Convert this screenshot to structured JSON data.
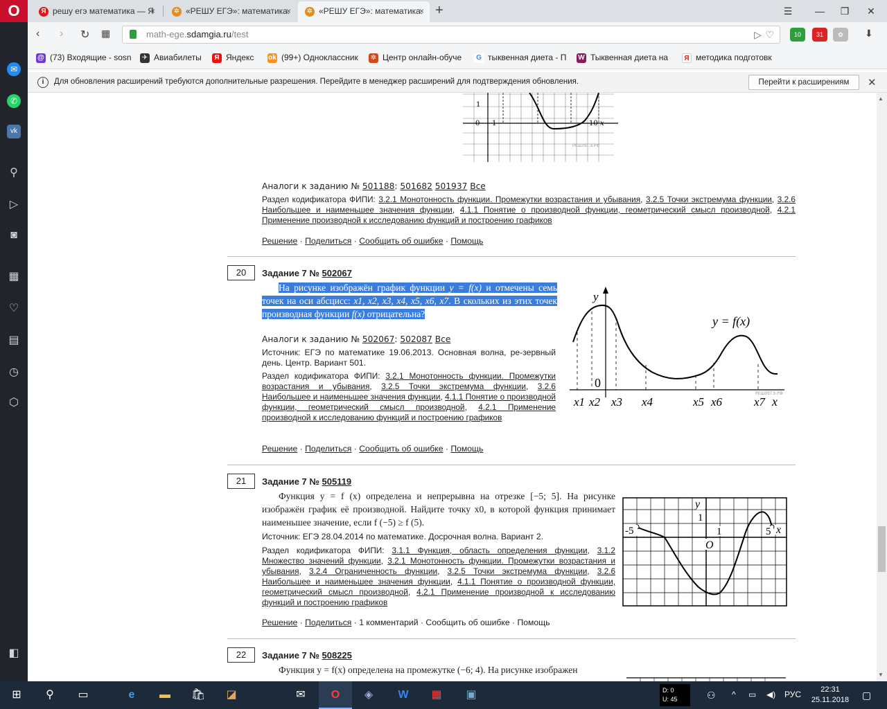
{
  "tabs": [
    {
      "title": "решу егэ математика — Я",
      "icon": "yandex-icon"
    },
    {
      "title": "«РЕШУ ЕГЭ»: математика.",
      "icon": "sdamgia-icon"
    },
    {
      "title": "«РЕШУ ЕГЭ»: математика.",
      "icon": "sdamgia-icon"
    }
  ],
  "address": {
    "host": "math-ege.",
    "domain": "sdamgia.ru",
    "path": "/test"
  },
  "ext_badges": {
    "green": "10",
    "red": "31"
  },
  "bookmarks": [
    "(73) Входящие - sosn",
    "Авиабилеты",
    "Яндекс",
    "(99+) Одноклассник",
    "Центр онлайн-обуче",
    "тыквенная диета - П",
    "Тыквенная диета на",
    "методика подготовк"
  ],
  "info": {
    "text": "Для обновления расширений требуются дополнительные разрешения. Перейдите в менеджер расширений для подтверждения обновления.",
    "button": "Перейти к расширениям"
  },
  "top": {
    "analog_prefix": "Аналоги к заданию № ",
    "analog_main": "501188",
    "analog_links": [
      "501682",
      "501937",
      "Все"
    ],
    "codif_prefix": "Раздел кодификатора ФИПИ:",
    "codif_links": [
      "3.2.1 Монотонность функции. Промежутки возрастания и убывания",
      "3.2.5 Точки экстремума функции",
      "3.2.6 Наибольшее и наименьшее значения функции",
      "4.1.1 Понятие о производной функции, геометрический смысл производной",
      "4.2.1 Применение производной к исследованию функций и построению графиков"
    ],
    "footer": [
      "Решение",
      "Поделиться",
      "Сообщить об ошибке",
      "Помощь"
    ]
  },
  "top_graph": {
    "labels": [
      "1",
      "0",
      "1",
      "10",
      "x"
    ],
    "wm": "РЕШУЕГЭ.РФ"
  },
  "t20": {
    "number": "20",
    "title": "Задание 7 № ",
    "id": "502067",
    "q1": "На рисунке изображён график функции ",
    "q_fx": "y = f(x)",
    "q2": " и отмечены семь точек на оси абсцисс: ",
    "q_pts": "x1, x2, x3, x4, x5, x6, x7",
    "q3": ". В скольких из этих точек производная функции ",
    "q_f": "f(x)",
    "q4": " отрицательна?",
    "analog_prefix": "Аналоги к заданию № ",
    "analog_main": "502067",
    "analog_links": [
      "502087",
      "Все"
    ],
    "source": "Источник: ЕГЭ по математике 19.06.2013. Основная волна, ре-зервный день. Центр. Вариант 501.",
    "codif_prefix": "Раздел кодификатора ФИПИ:",
    "codif_links": [
      "3.2.1 Монотонность функции. Промежутки возрастания и убывания",
      "3.2.5 Точки экстремума функции",
      "3.2.6 Наибольшее и наименьшее значения функции",
      "4.1.1 Понятие о производной функции, геометрический смысл производной",
      "4.2.1 Применение производной к исследованию функций и построению графиков"
    ],
    "footer": [
      "Решение",
      "Поделиться",
      "Сообщить об ошибке",
      "Помощь"
    ],
    "graph": {
      "ylabel": "y",
      "flabel": "y = f(x)",
      "origin": "0",
      "xlabel": "x",
      "pts": [
        "x1",
        "x2",
        "x3",
        "x4",
        "x5",
        "x6",
        "x7"
      ],
      "wm": "РЕШУЕГЭ.РФ"
    }
  },
  "t21": {
    "number": "21",
    "title": "Задание 7 № ",
    "id": "505119",
    "q": "Функция y = f (x) определена и непрерывна на отрезке [−5; 5]. На рисунке изображён график её производной. Найдите точку x0, в которой функция принимает наименьшее значение, если f (−5) ≥ f (5).",
    "source": "Источник: ЕГЭ 28.04.2014 по математике. Досрочная волна. Вариант 2.",
    "codif_prefix": "Раздел кодификатора ФИПИ:",
    "codif_links": [
      "3.1.1 Функция, область определения функции",
      "3.1.2 Множество значений функции",
      "3.2.1 Монотонность функции. Промежутки возрастания и убывания",
      "3.2.4 Ограниченность функции",
      "3.2.5 Точки экстремума функции",
      "3.2.6 Наибольшее и наименьшее значения функции",
      "4.1.1 Понятие о производной функции, геометрический смысл производной",
      "4.2.1 Применение производной к исследованию функций и построению графиков"
    ],
    "footer": [
      "Решение",
      "Поделиться",
      "1 комментарий",
      "Сообщить об ошибке",
      "Помощь"
    ],
    "graph": {
      "y": "y",
      "one_y": "1",
      "one_x": "1",
      "o": "O",
      "m5": "-5",
      "p5": "5",
      "x": "x"
    }
  },
  "t22": {
    "number": "22",
    "title": "Задание 7 № ",
    "id": "508225",
    "q": "Функция y = f(x) определена на промежутке (−6; 4). На рисунке изображен"
  },
  "taskbar": {
    "time": "22:31",
    "date": "25.11.2018",
    "lang": "РУС",
    "meter_d": "D: 0",
    "meter_u": "U: 45"
  }
}
